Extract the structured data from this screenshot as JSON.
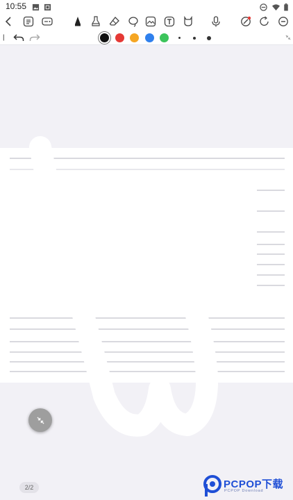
{
  "status_bar": {
    "time": "10:55",
    "icons": [
      "image-icon",
      "notification-icon",
      "dnd-icon",
      "wifi-icon",
      "battery-icon"
    ]
  },
  "toolbar": {
    "left": [
      "back-icon",
      "list-icon",
      "view-icon"
    ],
    "tools": [
      "pen-icon",
      "highlighter-icon",
      "eraser-icon",
      "lasso-icon",
      "image-insert-icon",
      "text-box-icon",
      "shape-icon",
      "microphone-icon"
    ],
    "right": [
      "sticker-icon",
      "redo-circle-icon",
      "more-icon"
    ]
  },
  "subbar": {
    "colors": [
      "#111111",
      "#e53935",
      "#f5a623",
      "#2f80ed",
      "#3cc45b"
    ],
    "selected_color_index": 0,
    "stroke_sizes": [
      "thin",
      "medium",
      "thick"
    ]
  },
  "page_indicator": {
    "text": "2/2"
  },
  "watermark": {
    "brand": "PCPOP下载",
    "sub": "PCPOP Download"
  },
  "colors": {
    "accent": "#1f4fd6",
    "canvas": "#f2f1f6",
    "page": "#ffffff",
    "rule": "#d9d9df"
  }
}
